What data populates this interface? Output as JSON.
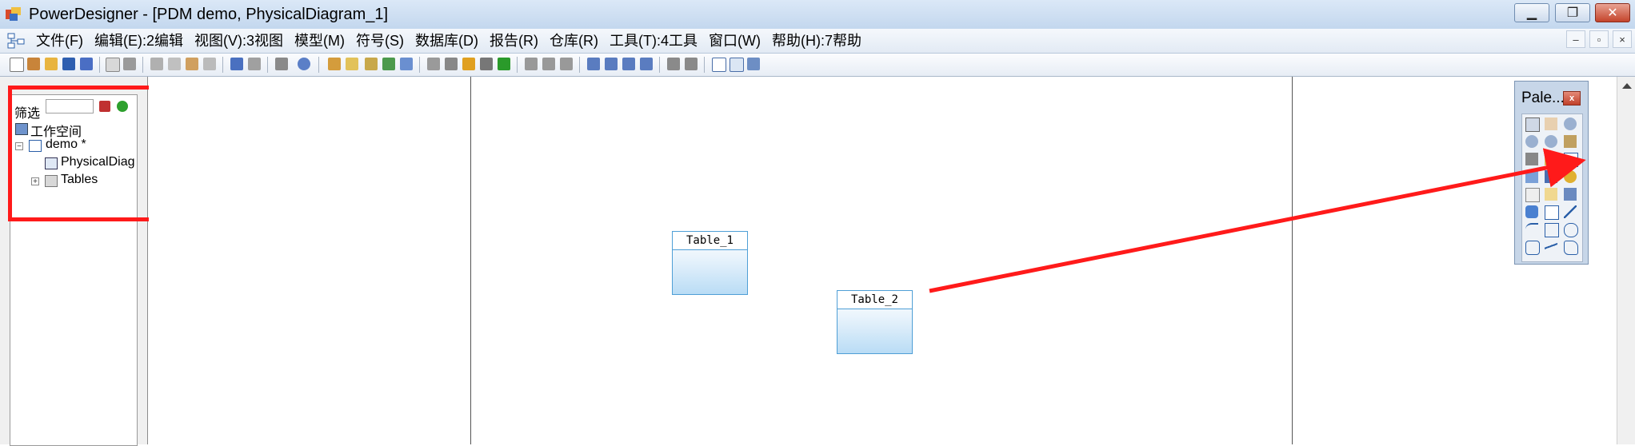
{
  "window": {
    "title": "PowerDesigner - [PDM demo, PhysicalDiagram_1]",
    "controls": [
      "minimize",
      "restore",
      "close"
    ]
  },
  "menu": {
    "items": [
      "文件(F)",
      "编辑(E):2编辑",
      "视图(V):3视图",
      "模型(M)",
      "符号(S)",
      "数据库(D)",
      "报告(R)",
      "仓库(R)",
      "工具(T):4工具",
      "窗口(W)",
      "帮助(H):7帮助"
    ],
    "mdi_controls": [
      "–",
      "▫",
      "×"
    ]
  },
  "browser": {
    "filter_label": "筛选",
    "filter_value": "",
    "tree": {
      "workspace": "工作空间",
      "model": "demo *",
      "diagram": "PhysicalDiag",
      "folder": "Tables"
    }
  },
  "diagram": {
    "tables": [
      {
        "name": "Table_1"
      },
      {
        "name": "Table_2"
      }
    ]
  },
  "palette": {
    "title": "Pale...",
    "close": "x"
  },
  "colors": {
    "highlight": "#ff1a1a",
    "table_border": "#4f9fd6",
    "arrow": "#ff1a1a"
  }
}
